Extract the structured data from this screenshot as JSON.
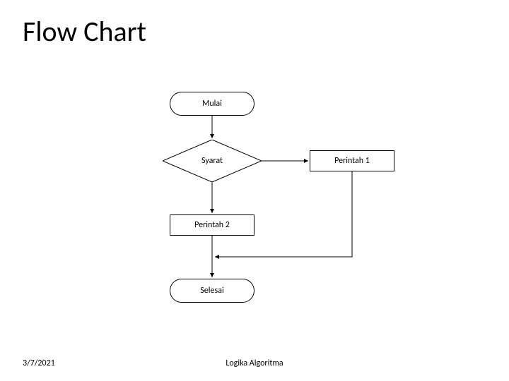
{
  "title": "Flow Chart",
  "nodes": {
    "mulai": "Mulai",
    "syarat": "Syarat",
    "perintah1": "Perintah 1",
    "perintah2": "Perintah 2",
    "selesai": "Selesai"
  },
  "footer": {
    "date": "3/7/2021",
    "caption": "Logika Algoritma"
  }
}
